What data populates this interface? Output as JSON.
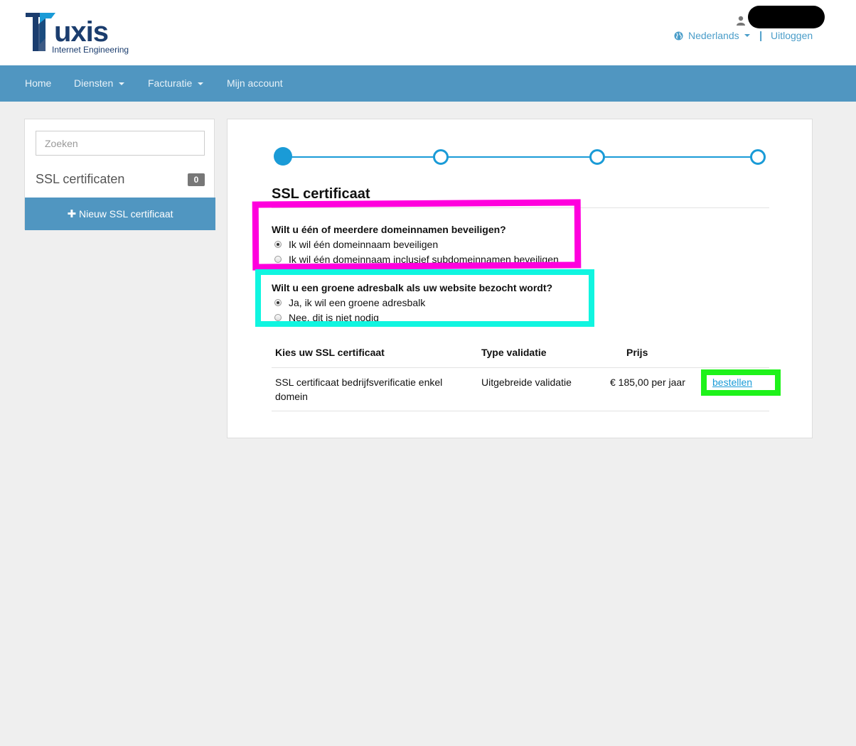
{
  "header": {
    "logo_text": "Tuxis",
    "logo_sub": "Internet Engineering",
    "language": "Nederlands",
    "separator": "|",
    "logout": "Uitloggen",
    "colors": {
      "brand": "#1b3d6e",
      "accent": "#1a9bd7",
      "link": "#4a9dc9"
    }
  },
  "nav": {
    "items": [
      {
        "label": "Home",
        "dropdown": false
      },
      {
        "label": "Diensten",
        "dropdown": true
      },
      {
        "label": "Facturatie",
        "dropdown": true
      },
      {
        "label": "Mijn account",
        "dropdown": false
      }
    ],
    "color": "#5096c1"
  },
  "sidebar": {
    "search_placeholder": "Zoeken",
    "title": "SSL certificaten",
    "count": "0",
    "new_button": "Nieuw SSL certificaat"
  },
  "main": {
    "stepper": {
      "steps": 4,
      "active": 1
    },
    "title": "SSL certificaat",
    "questions": [
      {
        "label": "Wilt u één of meerdere domeinnamen beveiligen?",
        "options": [
          {
            "label": "Ik wil één domeinnaam beveiligen",
            "selected": true
          },
          {
            "label": "Ik wil één domeinnaam inclusief subdomeinnamen beveiligen",
            "selected": false
          }
        ]
      },
      {
        "label": "Wilt u een groene adresbalk als uw website bezocht wordt?",
        "options": [
          {
            "label": "Ja, ik wil een groene adresbalk",
            "selected": true
          },
          {
            "label": "Nee, dit is niet nodig",
            "selected": false
          }
        ]
      }
    ],
    "table": {
      "headers": [
        "Kies uw SSL certificaat",
        "Type validatie",
        "Prijs",
        ""
      ],
      "rows": [
        {
          "name": "SSL certificaat bedrijfsverificatie enkel domein",
          "validation": "Uitgebreide validatie",
          "price": "€ 185,00",
          "period": "per jaar",
          "action": "bestellen"
        }
      ]
    }
  },
  "annotations": {
    "colors": [
      "#ff00dd",
      "#10f5e0",
      "#1ef21a"
    ]
  }
}
